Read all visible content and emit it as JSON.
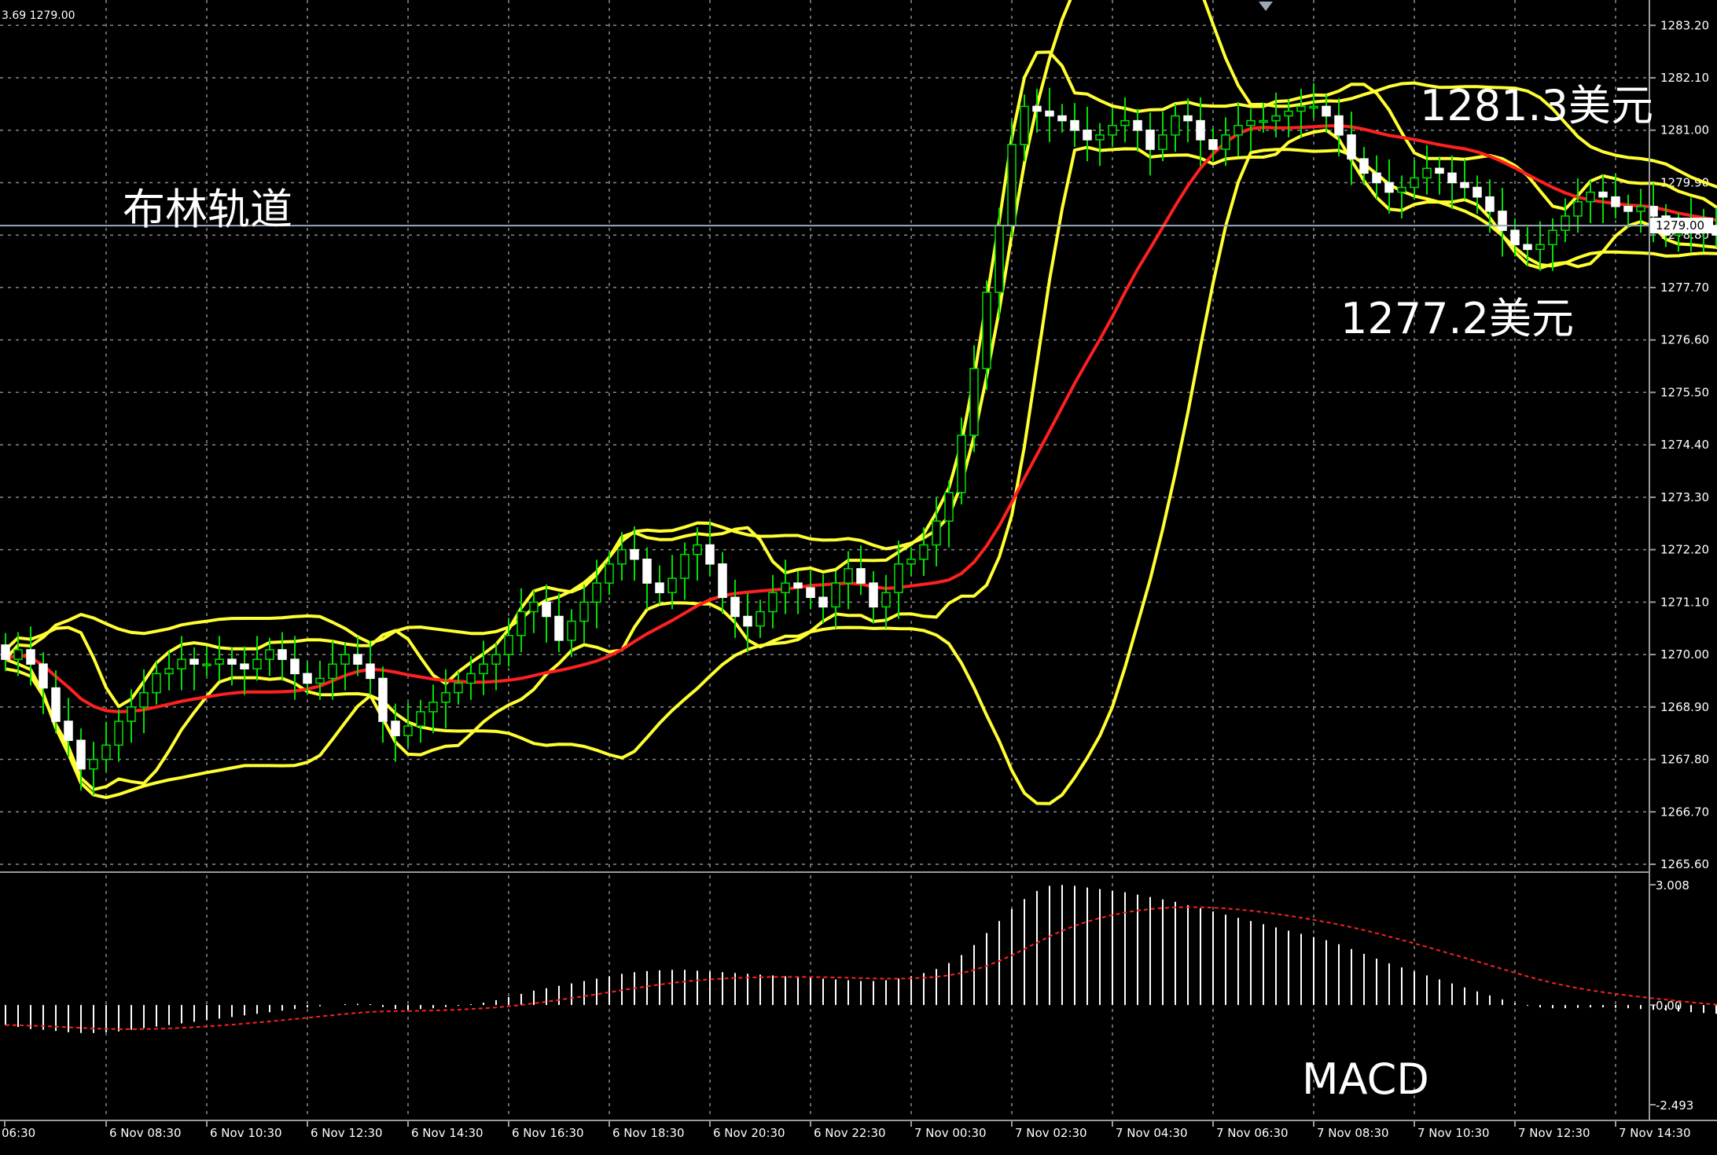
{
  "header": {
    "ohlc_readout": "3.69 1279.00"
  },
  "annotations": {
    "bollinger_label": "布林轨道",
    "upper_label": "1281.3美元",
    "lower_label": "1277.2美元",
    "macd_label": "MACD"
  },
  "colors": {
    "background": "#000000",
    "grid": "#8a8a8a",
    "bull_candle": "#00e000",
    "bear_candle": "#ffffff",
    "bands": "#ffff33",
    "middle_band": "#ff2020",
    "macd_hist": "#ffffff",
    "macd_signal": "#ff2020",
    "price_line": "#9aa8b8"
  },
  "chart_data": {
    "type": "candlestick",
    "price_axis": {
      "range": [
        1265.6,
        1283.6
      ],
      "tick_labels": [
        "1283.20",
        "1282.10",
        "1281.00",
        "1279.90",
        "1278.80",
        "1277.70",
        "1276.60",
        "1275.50",
        "1274.40",
        "1273.30",
        "1272.20",
        "1271.10",
        "1270.00",
        "1268.90",
        "1267.80",
        "1266.70",
        "1265.60"
      ],
      "current_price": "1279.00",
      "current_value": 1279.0
    },
    "time_axis": {
      "labels": [
        "06:30",
        "6 Nov 08:30",
        "6 Nov 10:30",
        "6 Nov 12:30",
        "6 Nov 14:30",
        "6 Nov 16:30",
        "6 Nov 18:30",
        "6 Nov 20:30",
        "6 Nov 22:30",
        "7 Nov 00:30",
        "7 Nov 02:30",
        "7 Nov 04:30",
        "7 Nov 06:30",
        "7 Nov 08:30",
        "7 Nov 10:30",
        "7 Nov 12:30",
        "7 Nov 14:30"
      ],
      "bars_between_labels": 8
    },
    "close": [
      1269.9,
      1270.1,
      1269.8,
      1269.3,
      1268.6,
      1268.2,
      1267.6,
      1267.8,
      1268.1,
      1268.6,
      1268.9,
      1269.2,
      1269.6,
      1269.7,
      1269.9,
      1269.8,
      1269.8,
      1269.9,
      1269.8,
      1269.7,
      1269.9,
      1270.1,
      1269.9,
      1269.6,
      1269.4,
      1269.5,
      1269.8,
      1270.0,
      1269.8,
      1269.5,
      1268.6,
      1268.3,
      1268.5,
      1268.8,
      1269.0,
      1269.2,
      1269.4,
      1269.6,
      1269.8,
      1270.0,
      1270.4,
      1270.9,
      1271.1,
      1270.8,
      1270.3,
      1270.7,
      1271.1,
      1271.5,
      1271.9,
      1272.2,
      1272.0,
      1271.5,
      1271.3,
      1271.6,
      1272.1,
      1272.3,
      1271.9,
      1271.2,
      1270.8,
      1270.6,
      1270.9,
      1271.3,
      1271.5,
      1271.4,
      1271.2,
      1271.0,
      1271.5,
      1271.8,
      1271.5,
      1271.0,
      1271.3,
      1271.9,
      1272.0,
      1272.3,
      1272.8,
      1273.4,
      1274.6,
      1276.0,
      1277.6,
      1279.0,
      1280.7,
      1281.5,
      1281.4,
      1281.3,
      1281.2,
      1281.0,
      1280.8,
      1280.9,
      1281.1,
      1281.2,
      1281.0,
      1280.6,
      1280.9,
      1281.3,
      1281.2,
      1280.8,
      1280.6,
      1280.9,
      1281.1,
      1281.2,
      1281.2,
      1281.3,
      1281.4,
      1281.5,
      1281.5,
      1281.3,
      1280.9,
      1280.4,
      1280.1,
      1279.9,
      1279.7,
      1279.8,
      1280.0,
      1280.2,
      1280.1,
      1279.9,
      1279.8,
      1279.6,
      1279.3,
      1278.9,
      1278.6,
      1278.5,
      1278.6,
      1278.9,
      1279.2,
      1279.5,
      1279.7,
      1279.6,
      1279.4,
      1279.3,
      1279.4,
      1279.2,
      1278.8,
      1278.9,
      1279.1,
      1279.0,
      1278.8,
      1278.7,
      1278.9,
      1279.0
    ]
  },
  "macd_panel": {
    "tick_labels": [
      "3.008",
      "0.00",
      "-2.493"
    ],
    "range": [
      -2.493,
      3.008
    ],
    "histogram": [
      -0.5,
      -0.55,
      -0.6,
      -0.62,
      -0.65,
      -0.68,
      -0.7,
      -0.7,
      -0.68,
      -0.66,
      -0.62,
      -0.58,
      -0.54,
      -0.5,
      -0.46,
      -0.42,
      -0.38,
      -0.34,
      -0.3,
      -0.26,
      -0.22,
      -0.18,
      -0.14,
      -0.1,
      -0.06,
      -0.03,
      0.0,
      0.02,
      0.03,
      0.02,
      -0.05,
      -0.1,
      -0.12,
      -0.1,
      -0.08,
      -0.05,
      -0.02,
      0.02,
      0.06,
      0.12,
      0.2,
      0.28,
      0.36,
      0.42,
      0.48,
      0.54,
      0.6,
      0.66,
      0.72,
      0.78,
      0.82,
      0.85,
      0.87,
      0.88,
      0.88,
      0.86,
      0.84,
      0.82,
      0.8,
      0.78,
      0.76,
      0.74,
      0.72,
      0.7,
      0.68,
      0.66,
      0.64,
      0.62,
      0.6,
      0.6,
      0.62,
      0.66,
      0.72,
      0.8,
      0.9,
      1.05,
      1.25,
      1.5,
      1.8,
      2.1,
      2.4,
      2.65,
      2.85,
      2.98,
      3.0,
      2.98,
      2.94,
      2.9,
      2.86,
      2.82,
      2.76,
      2.7,
      2.64,
      2.58,
      2.5,
      2.42,
      2.34,
      2.26,
      2.18,
      2.1,
      2.02,
      1.94,
      1.86,
      1.78,
      1.7,
      1.62,
      1.52,
      1.4,
      1.28,
      1.16,
      1.04,
      0.94,
      0.84,
      0.74,
      0.64,
      0.54,
      0.44,
      0.34,
      0.24,
      0.14,
      0.05,
      -0.02,
      -0.06,
      -0.08,
      -0.08,
      -0.07,
      -0.06,
      -0.06,
      -0.07,
      -0.08,
      -0.1,
      -0.12,
      -0.14,
      -0.16,
      -0.18,
      -0.2,
      -0.22,
      -0.24,
      -0.26,
      -0.28
    ]
  }
}
